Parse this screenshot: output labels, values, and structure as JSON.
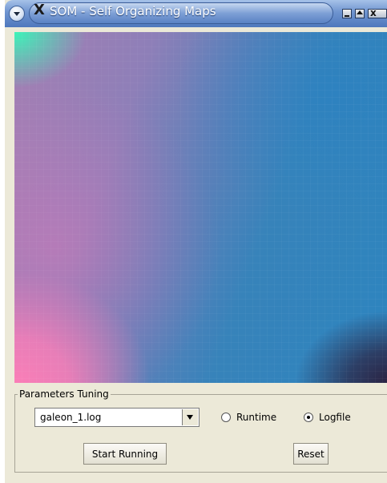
{
  "window": {
    "title": "SOM - Self Organizing Maps",
    "app_icon": "X",
    "controls": {
      "menu_icon": "window-menu-icon",
      "minimize_icon": "minimize-icon",
      "maximize_icon": "maximize-icon",
      "close_icon": "close-icon",
      "close_glyph": "x"
    }
  },
  "params": {
    "group_label": "Parameters Tuning",
    "file_select": {
      "value": "galeon_1.log"
    },
    "radio_runtime": {
      "label": "Runtime",
      "checked": false
    },
    "radio_logfile": {
      "label": "Logfile",
      "checked": true
    },
    "start_label": "Start Running",
    "reset_label": "Reset"
  },
  "colors": {
    "map_pink": "#ff7fb7",
    "map_blue": "#2c84bf",
    "map_mint": "#3bf4b8",
    "map_dark": "#2b2140"
  }
}
